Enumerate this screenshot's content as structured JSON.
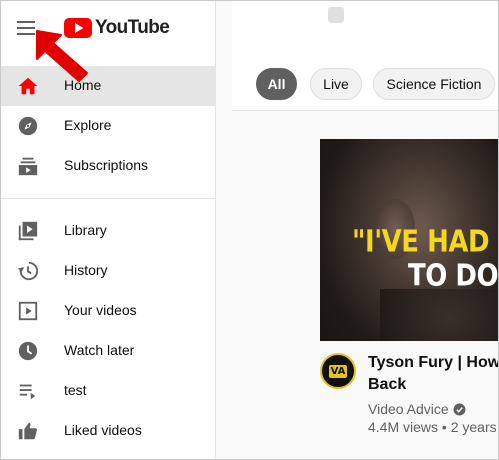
{
  "brand": {
    "logo_text": "YouTube",
    "red": "#ff0000"
  },
  "sidebar": {
    "items": [
      {
        "label": "Home",
        "icon": "home-icon",
        "active": true
      },
      {
        "label": "Explore",
        "icon": "compass-icon"
      },
      {
        "label": "Subscriptions",
        "icon": "subscriptions-icon"
      },
      {
        "label": "Library",
        "icon": "library-icon"
      },
      {
        "label": "History",
        "icon": "history-icon"
      },
      {
        "label": "Your videos",
        "icon": "play-square-icon"
      },
      {
        "label": "Watch later",
        "icon": "clock-icon"
      },
      {
        "label": "test",
        "icon": "playlist-icon"
      },
      {
        "label": "Liked videos",
        "icon": "thumbs-up-icon"
      }
    ]
  },
  "chips": [
    {
      "label": "All",
      "selected": true
    },
    {
      "label": "Live"
    },
    {
      "label": "Science Fiction"
    }
  ],
  "video": {
    "thumb_text_line1": "\"I'VE HAD ZER",
    "thumb_text_line2": "TO DO AN",
    "title_line1": "Tyson Fury | How T",
    "title_line2": "Back",
    "channel": "Video Advice",
    "avatar_text": "VA",
    "meta": "4.4M views • 2 years"
  },
  "annotation": {
    "arrow_color": "#e00000"
  }
}
